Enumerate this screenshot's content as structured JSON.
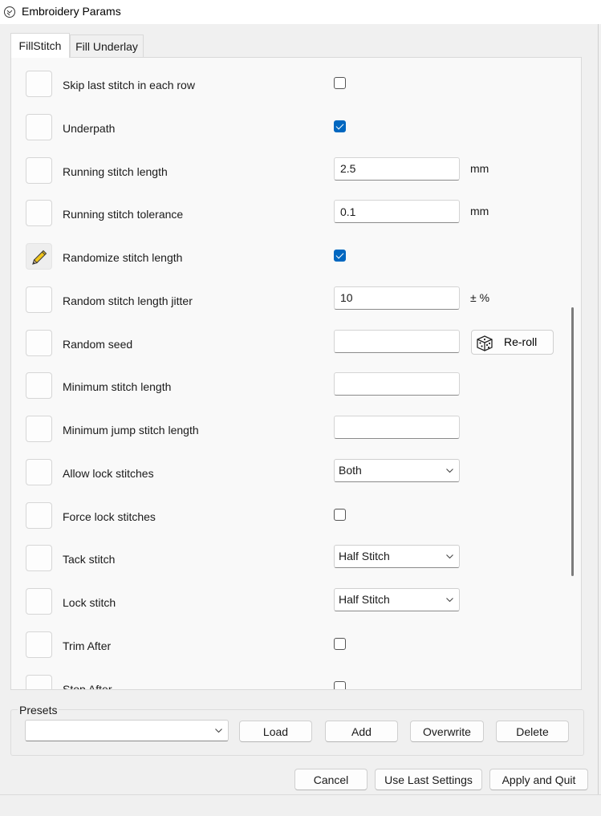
{
  "window": {
    "title": "Embroidery Params"
  },
  "tabs": [
    {
      "label": "FillStitch",
      "active": true
    },
    {
      "label": "Fill Underlay",
      "active": false
    }
  ],
  "params": [
    {
      "label": "Skip last stitch in each row",
      "control": "checkbox",
      "checked": false
    },
    {
      "label": "Underpath",
      "control": "checkbox",
      "checked": true
    },
    {
      "label": "Running stitch length",
      "control": "text",
      "value": "2.5",
      "unit": "mm"
    },
    {
      "label": "Running stitch tolerance",
      "control": "text",
      "value": "0.1",
      "unit": "mm"
    },
    {
      "label": "Randomize stitch length",
      "control": "checkbox",
      "checked": true,
      "modified": true
    },
    {
      "label": "Random stitch length jitter",
      "control": "text",
      "value": "10",
      "unit": "± %"
    },
    {
      "label": "Random seed",
      "control": "text",
      "value": "",
      "button": "Re-roll"
    },
    {
      "label": "Minimum stitch length",
      "control": "text",
      "value": ""
    },
    {
      "label": "Minimum jump stitch length",
      "control": "text",
      "value": ""
    },
    {
      "label": "Allow lock stitches",
      "control": "select",
      "value": "Both"
    },
    {
      "label": "Force lock stitches",
      "control": "checkbox",
      "checked": false
    },
    {
      "label": "Tack stitch",
      "control": "select",
      "value": "Half Stitch"
    },
    {
      "label": "Lock stitch",
      "control": "select",
      "value": "Half Stitch"
    },
    {
      "label": "Trim After",
      "control": "checkbox",
      "checked": false
    },
    {
      "label": "Stop After",
      "control": "checkbox",
      "checked": false
    }
  ],
  "presets": {
    "title": "Presets",
    "selected": "",
    "load": "Load",
    "add": "Add",
    "overwrite": "Overwrite",
    "delete": "Delete"
  },
  "footer": {
    "cancel": "Cancel",
    "use_last": "Use Last Settings",
    "apply": "Apply and Quit"
  },
  "colors": {
    "accent": "#0067c0",
    "pencil": "#f0c419"
  },
  "icons": {
    "modified": "pencil-icon",
    "reroll": "dice-icon",
    "dropdown": "chevron-down-icon"
  }
}
